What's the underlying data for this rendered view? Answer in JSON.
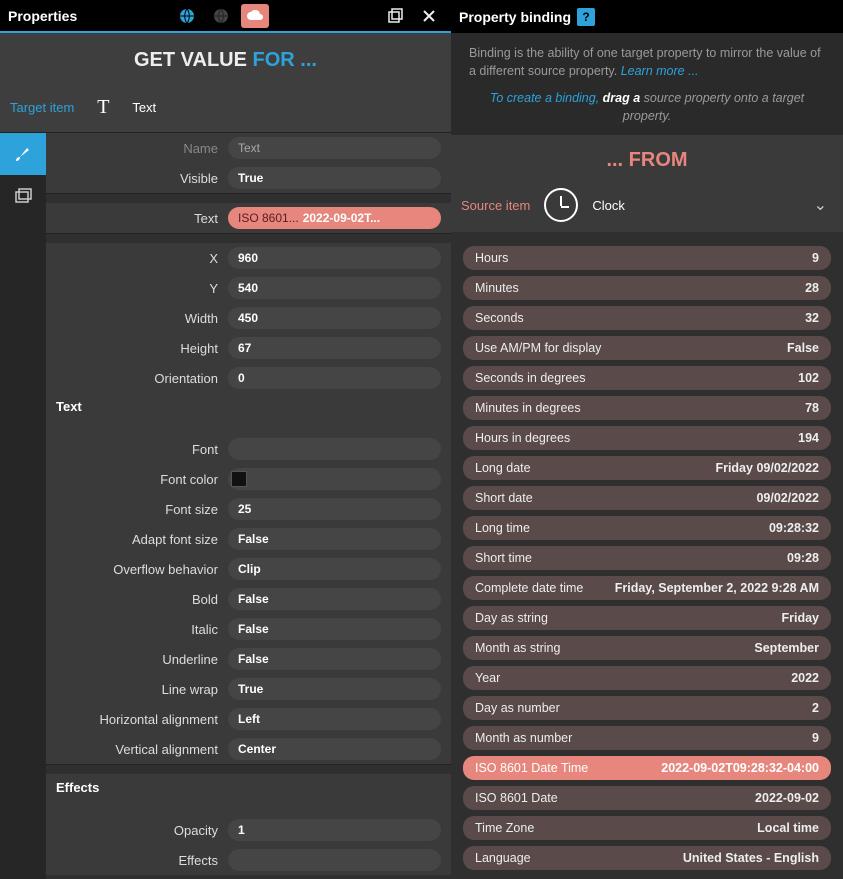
{
  "left_header": {
    "title": "Properties"
  },
  "right_header": {
    "title": "Property binding"
  },
  "title": {
    "prefix": "GET VALUE ",
    "suffix": "FOR ..."
  },
  "target": {
    "label": "Target item",
    "name": "Text"
  },
  "intro": {
    "desc": "Binding is the ability of one target property to mirror the value of a different source property. ",
    "learn": "Learn more ...",
    "tip_pre": "To create a binding, ",
    "tip_drag": "drag  a",
    "tip_post": "  source property onto a target property."
  },
  "from": {
    "title": "... FROM",
    "source_label": "Source item",
    "source_name": "Clock"
  },
  "props": {
    "name": {
      "label": "Name",
      "value": "Text"
    },
    "visible": {
      "label": "Visible",
      "value": "True"
    },
    "text": {
      "label": "Text",
      "src": "ISO 8601...",
      "value": "2022-09-02T..."
    },
    "x": {
      "label": "X",
      "value": "960"
    },
    "y": {
      "label": "Y",
      "value": "540"
    },
    "width": {
      "label": "Width",
      "value": "450"
    },
    "height": {
      "label": "Height",
      "value": "67"
    },
    "orientation": {
      "label": "Orientation",
      "value": "0"
    },
    "section_text": "Text",
    "font": {
      "label": "Font",
      "value": ""
    },
    "font_color": {
      "label": "Font color",
      "value": "#111111"
    },
    "font_size": {
      "label": "Font size",
      "value": "25"
    },
    "adapt": {
      "label": "Adapt font size",
      "value": "False"
    },
    "overflow": {
      "label": "Overflow behavior",
      "value": "Clip"
    },
    "bold": {
      "label": "Bold",
      "value": "False"
    },
    "italic": {
      "label": "Italic",
      "value": "False"
    },
    "underline": {
      "label": "Underline",
      "value": "False"
    },
    "linewrap": {
      "label": "Line wrap",
      "value": "True"
    },
    "halign": {
      "label": "Horizontal alignment",
      "value": "Left"
    },
    "valign": {
      "label": "Vertical alignment",
      "value": "Center"
    },
    "section_effects": "Effects",
    "opacity": {
      "label": "Opacity",
      "value": "1"
    },
    "effects": {
      "label": "Effects",
      "value": ""
    }
  },
  "source_props": [
    {
      "name": "Hours",
      "value": "9"
    },
    {
      "name": "Minutes",
      "value": "28"
    },
    {
      "name": "Seconds",
      "value": "32"
    },
    {
      "name": "Use AM/PM for display",
      "value": "False"
    },
    {
      "name": "Seconds in degrees",
      "value": "102"
    },
    {
      "name": "Minutes in degrees",
      "value": "78"
    },
    {
      "name": "Hours in degrees",
      "value": "194"
    },
    {
      "name": "Long date",
      "value": "Friday 09/02/2022"
    },
    {
      "name": "Short date",
      "value": "09/02/2022"
    },
    {
      "name": "Long time",
      "value": "09:28:32"
    },
    {
      "name": "Short time",
      "value": "09:28"
    },
    {
      "name": "Complete date time",
      "value": "Friday, September 2, 2022 9:28 AM"
    },
    {
      "name": "Day as string",
      "value": "Friday"
    },
    {
      "name": "Month as string",
      "value": "September"
    },
    {
      "name": "Year",
      "value": "2022"
    },
    {
      "name": "Day as number",
      "value": "2"
    },
    {
      "name": "Month as number",
      "value": "9"
    },
    {
      "name": "ISO 8601 Date Time",
      "value": "2022-09-02T09:28:32-04:00",
      "selected": true
    },
    {
      "name": "ISO 8601 Date",
      "value": "2022-09-02"
    },
    {
      "name": "Time Zone",
      "value": "Local time"
    },
    {
      "name": "Language",
      "value": "United States - English"
    }
  ]
}
